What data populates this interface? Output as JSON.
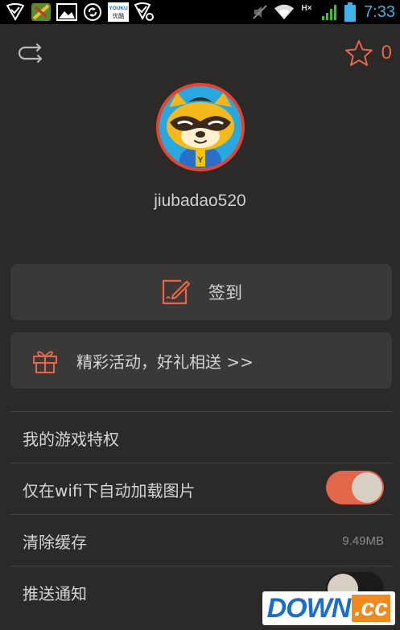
{
  "status_bar": {
    "time": "7:33",
    "icons": [
      "notification-shield-icon",
      "game-app-icon",
      "image-icon",
      "sync-icon",
      "youku-app-icon",
      "shield-settings-icon",
      "mute-icon",
      "wifi-icon",
      "network-hx-icon",
      "signal-icon",
      "battery-icon"
    ],
    "youku_label": "YOUKU",
    "youku_sublabel": "优酷",
    "network_label": "H×",
    "accent": "#3db3e8"
  },
  "header": {
    "back_icon": "return-arrow-icon",
    "favorite_icon": "star-icon",
    "favorite_count": "0",
    "accent": "#e8654a"
  },
  "profile": {
    "avatar_icon": "raccoon-mascot-avatar",
    "username": "jiubadao520"
  },
  "checkin": {
    "label": "签到",
    "icon": "edit-sign-icon"
  },
  "events": {
    "label": "精彩活动，好礼相送 >>",
    "icon": "gift-icon"
  },
  "settings": {
    "privileges_label": "我的游戏特权",
    "wifi_only_label": "仅在wifi下自动加载图片",
    "wifi_only_enabled": true,
    "clear_cache_label": "清除缓存",
    "cache_size": "9.49MB",
    "push_label": "推送通知",
    "push_enabled": false
  },
  "watermark": {
    "text": "DOWN",
    "suffix": ".cc"
  }
}
